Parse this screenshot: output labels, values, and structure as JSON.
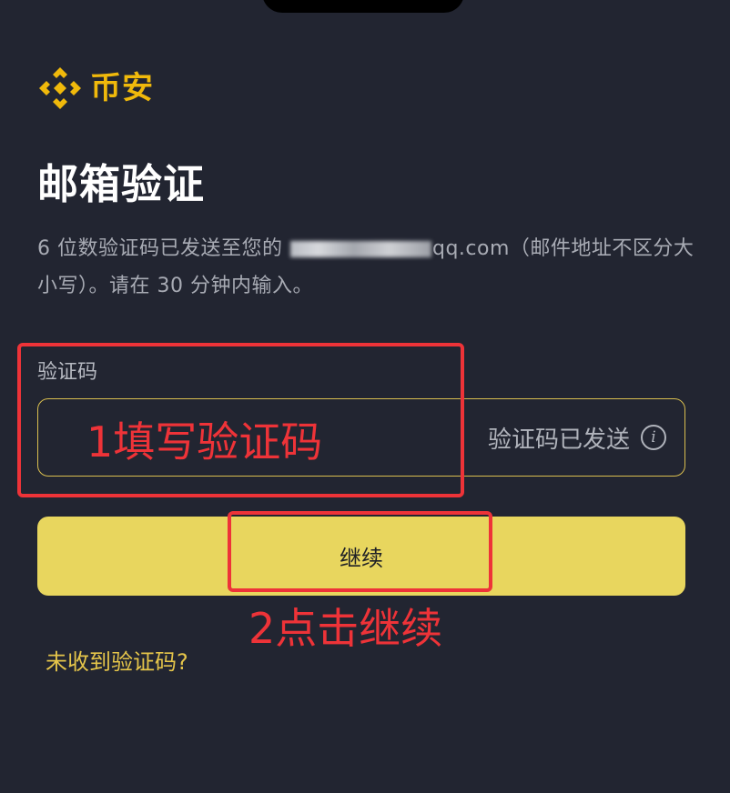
{
  "brand": {
    "name": "币安",
    "logo_icon": "binance-diamond-icon",
    "color": "#F0B90B"
  },
  "page": {
    "title": "邮箱验证",
    "description_before_email": "6 位数验证码已发送至您的",
    "email_visible_suffix": "qq.com",
    "description_after_email": "（邮件地址不区分大小写）。请在 30 分钟内输入。"
  },
  "code_field": {
    "label": "验证码",
    "value": "",
    "sent_status": "验证码已发送",
    "info_icon": "info-circle-icon",
    "border_color": "#D9BE4F"
  },
  "continue_button": {
    "label": "继续",
    "color": "#E8D65E"
  },
  "resend_link": {
    "label": "未收到验证码?"
  },
  "annotations": {
    "step1": "1填写验证码",
    "step2": "2点击继续",
    "color": "#EE3338"
  },
  "colors": {
    "background": "#222531",
    "title": "#ffffff",
    "muted_text": "#a8abb4"
  }
}
